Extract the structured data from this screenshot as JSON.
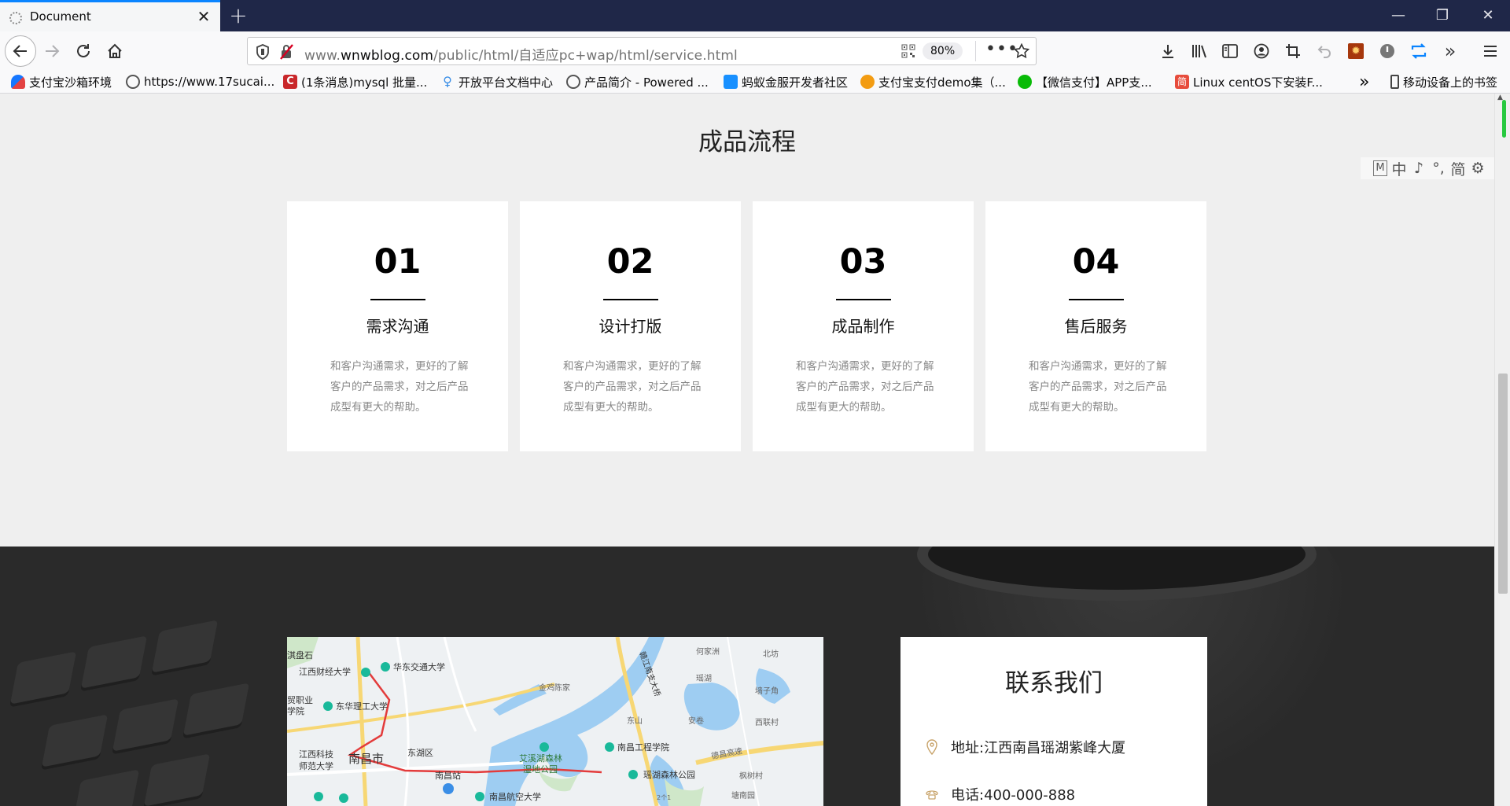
{
  "browser": {
    "tab_title": "Document",
    "url_prefix": "www.",
    "url_domain": "wnwblog.com",
    "url_path": "/public/html/自适应pc+wap/html/service.html",
    "zoom": "80%"
  },
  "bookmarks": [
    {
      "label": "支付宝沙箱环境",
      "icon_color": "#1677ff"
    },
    {
      "label": "https://www.17sucai...",
      "icon_color": "#555555"
    },
    {
      "label": "(1条消息)mysql 批量...",
      "icon_color": "#c9272a"
    },
    {
      "label": "开放平台文档中心",
      "icon_color": "#3a8ee6"
    },
    {
      "label": "产品简介 - Powered ...",
      "icon_color": "#555555"
    },
    {
      "label": "蚂蚁金服开发者社区",
      "icon_color": "#1890ff"
    },
    {
      "label": "支付宝支付demo集（...",
      "icon_color": "#f39c12"
    },
    {
      "label": "【微信支付】APP支...",
      "icon_color": "#09bb07"
    },
    {
      "label": "Linux centOS下安装F...",
      "icon_color": "#e74c3c"
    }
  ],
  "bookmarks_mobile": "移动设备上的书签",
  "process": {
    "title": "成品流程",
    "cards": [
      {
        "num": "01",
        "name": "需求沟通",
        "desc": "和客户沟通需求，更好的了解客户的产品需求，对之后产品成型有更大的帮助。"
      },
      {
        "num": "02",
        "name": "设计打版",
        "desc": "和客户沟通需求，更好的了解客户的产品需求，对之后产品成型有更大的帮助。"
      },
      {
        "num": "03",
        "name": "成品制作",
        "desc": "和客户沟通需求，更好的了解客户的产品需求，对之后产品成型有更大的帮助。"
      },
      {
        "num": "04",
        "name": "售后服务",
        "desc": "和客户沟通需求，更好的了解客户的产品需求，对之后产品成型有更大的帮助。"
      }
    ]
  },
  "contact": {
    "title": "联系我们",
    "address": "地址:江西南昌瑶湖紫峰大厦",
    "phone": "电话:400-000-888"
  },
  "map": {
    "labels": [
      "淇盘石",
      "江西财经大学",
      "华东交通大学",
      "贸职业",
      "学院",
      "东华理工大学",
      "江西科技",
      "师范大学",
      "南昌市",
      "东湖区",
      "南昌站",
      "金鸡陈家",
      "何家洲",
      "北坊",
      "艾溪湖森林",
      "湿地公园",
      "南昌工程学院",
      "瑶湖森林公园",
      "南昌航空大学",
      "赣江南支大桥",
      "东山",
      "安卷",
      "墙子角",
      "西联村",
      "德昌高速",
      "枫树村",
      "塘南园",
      "2个1",
      "瑶湖"
    ]
  },
  "ime": [
    "M",
    "中",
    "♪",
    "°,",
    "简",
    "⚙"
  ]
}
